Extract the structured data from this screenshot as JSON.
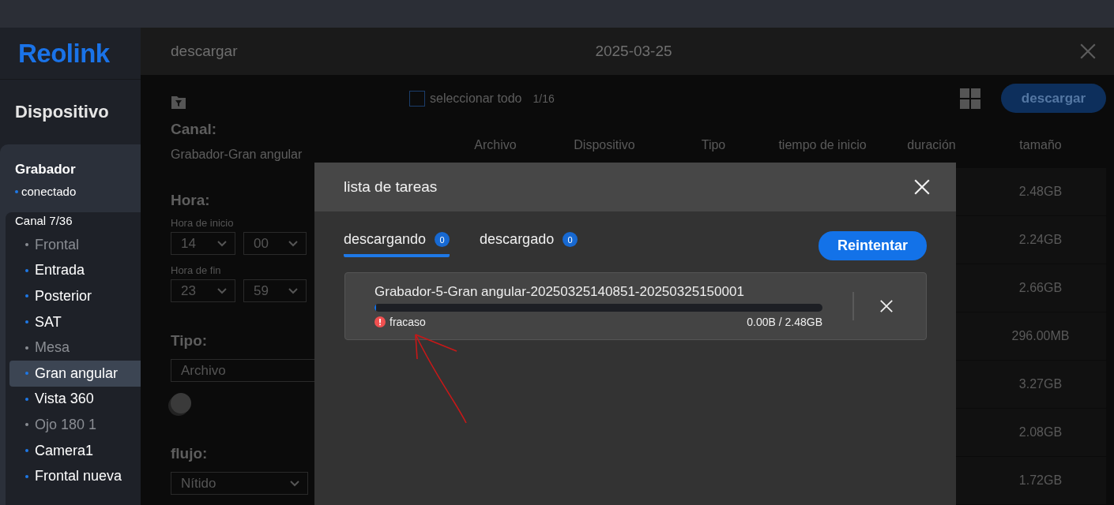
{
  "logo": "Reolink",
  "sidebar": {
    "title": "Dispositivo",
    "device": {
      "name": "Grabador",
      "status": "conectado",
      "online": true
    },
    "channel_count": "Canal 7/36",
    "channels": [
      {
        "name": "Frontal",
        "online": false,
        "selected": false
      },
      {
        "name": "Entrada",
        "online": true,
        "selected": false
      },
      {
        "name": "Posterior",
        "online": true,
        "selected": false
      },
      {
        "name": "SAT",
        "online": true,
        "selected": false
      },
      {
        "name": "Mesa",
        "online": false,
        "selected": false
      },
      {
        "name": "Gran angular",
        "online": true,
        "selected": true
      },
      {
        "name": "Vista 360",
        "online": true,
        "selected": false
      },
      {
        "name": "Ojo 180 1",
        "online": false,
        "selected": false
      },
      {
        "name": "Camera1",
        "online": true,
        "selected": false
      },
      {
        "name": "Frontal nueva",
        "online": true,
        "selected": false
      }
    ]
  },
  "header": {
    "title": "descargar",
    "date": "2025-03-25"
  },
  "filters": {
    "channel_label": "Canal:",
    "channel_value": "Grabador-Gran angular",
    "time_label": "Hora:",
    "start_label": "Hora de inicio",
    "start_hour": "14",
    "start_minute": "00",
    "end_label": "Hora de fin",
    "end_hour": "23",
    "end_minute": "59",
    "type_label": "Tipo:",
    "type_value": "Archivo",
    "toggle_on": false,
    "stream_label": "flujo:",
    "stream_value": "Nítido"
  },
  "toolbar": {
    "select_all": "seleccionar todo",
    "select_all_checked": false,
    "count": "1/16",
    "download": "descargar"
  },
  "table": {
    "columns": [
      "Archivo",
      "Dispositivo",
      "Tipo",
      "tiempo de inicio",
      "duración",
      "tamaño"
    ],
    "rows": [
      {
        "size": "2.48GB"
      },
      {
        "size": "2.24GB"
      },
      {
        "size": "2.66GB"
      },
      {
        "size": "296.00MB"
      },
      {
        "size": "3.27GB"
      },
      {
        "size": "2.08GB"
      },
      {
        "size": "1.72GB"
      }
    ]
  },
  "dialog": {
    "title": "lista de tareas",
    "tabs": [
      {
        "label": "descargando",
        "count": "0",
        "selected": true
      },
      {
        "label": "descargado",
        "count": "0",
        "selected": false
      }
    ],
    "retry": "Reintentar",
    "tasks": [
      {
        "name": "Grabador-5-Gran angular-20250325140851-20250325150001",
        "level": 0,
        "status": "fracaso",
        "failed": true,
        "progress": "0.00B / 2.48GB"
      }
    ]
  }
}
